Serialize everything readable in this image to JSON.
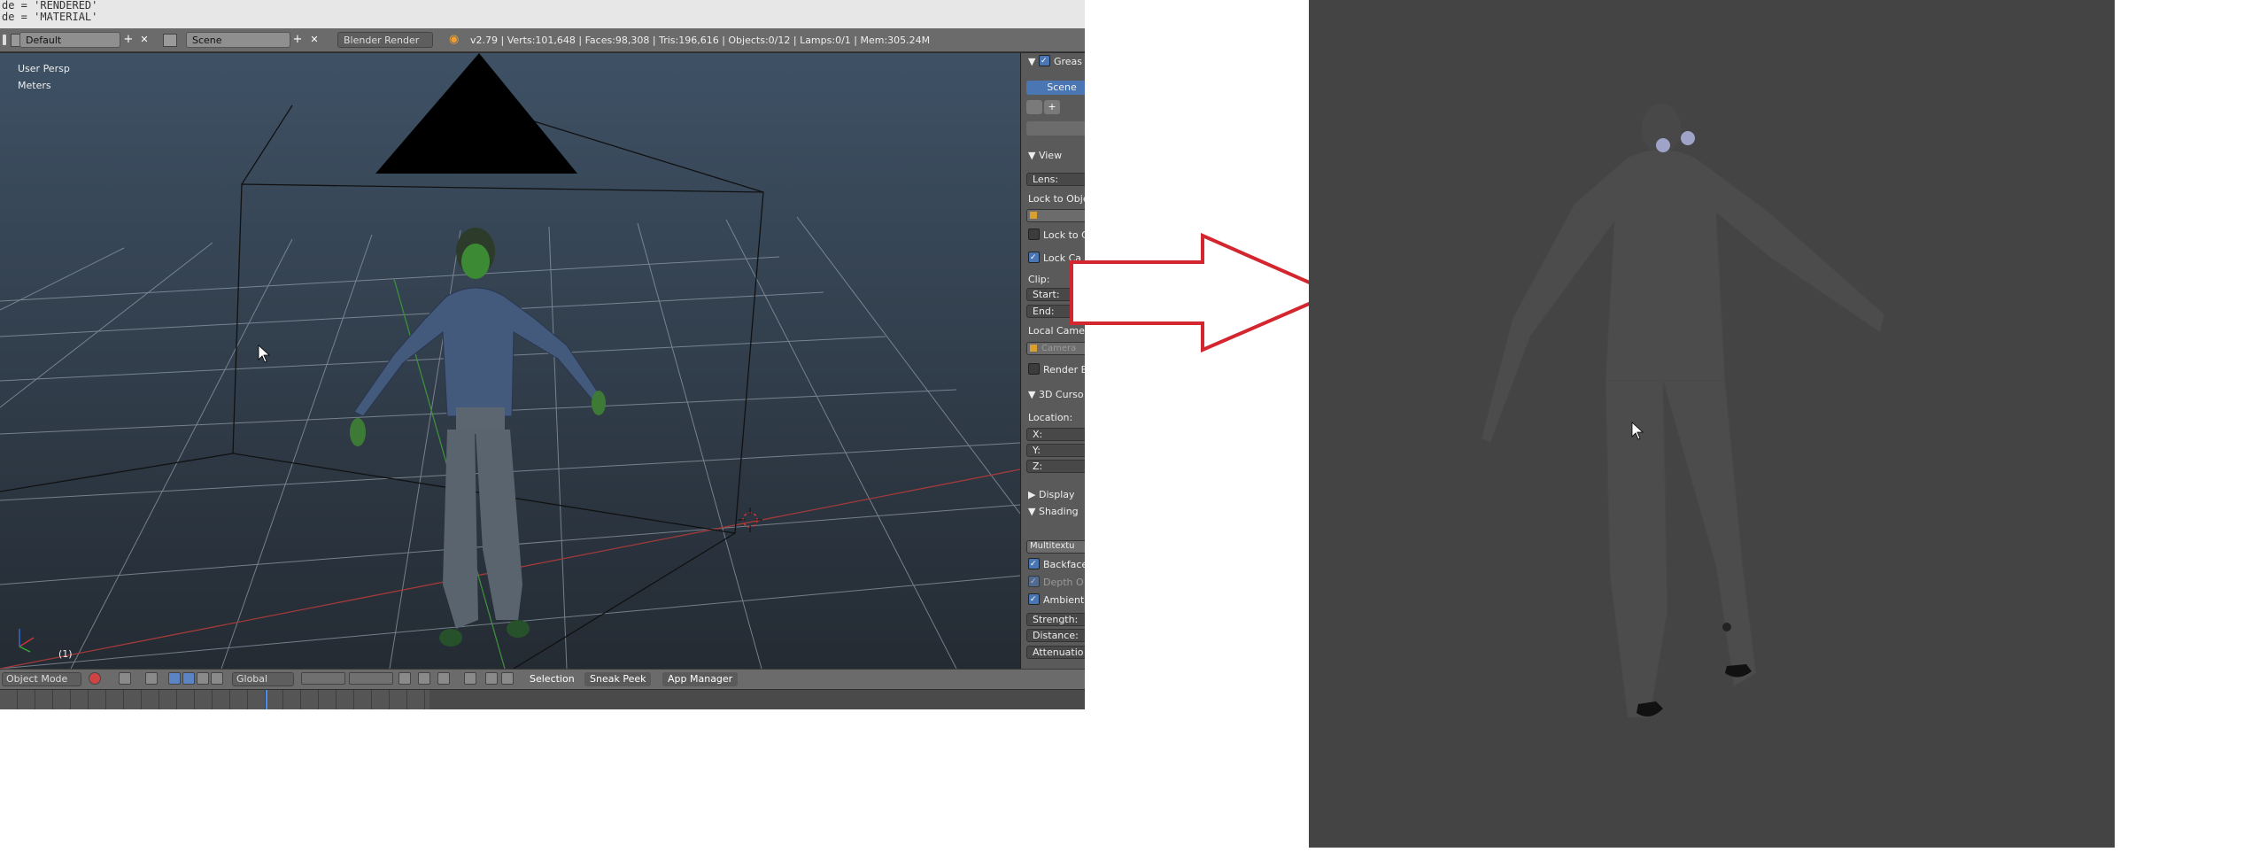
{
  "console": {
    "line1": "de = 'RENDERED'",
    "line2": "de = 'MATERIAL'"
  },
  "infobar": {
    "layout_name": "Default",
    "scene_name": "Scene",
    "render_engine": "Blender Render",
    "stats": "v2.79 | Verts:101,648 | Faces:98,308 | Tris:196,616 | Objects:0/12 | Lamps:0/1 | Mem:305.24M",
    "add_symbol": "+",
    "close_symbol": "✕"
  },
  "viewport": {
    "view_name": "User Persp",
    "units": "Meters",
    "frame": "(1)"
  },
  "npanel": {
    "grease_header": "Greas",
    "scene_tab": "Scene",
    "view_header": "View",
    "lens_label": "Lens:",
    "lock_to_object": "Lock to Obje",
    "lock_to_cursor": "Lock to C",
    "lock_camera": "Lock Ca",
    "clip_label": "Clip:",
    "start_label": "Start:",
    "end_label": "End:",
    "local_camera": "Local Came",
    "local_camera_value": "Camera",
    "render_border": "Render B",
    "cursor_header": "3D Curso",
    "location_label": "Location:",
    "x_label": "X:",
    "y_label": "Y:",
    "z_label": "Z:",
    "display_header": "Display",
    "shading_header": "Shading",
    "shading_mode": "Multitextu",
    "backface": "Backface",
    "depth_of_field": "Depth O",
    "ambient": "Ambient",
    "strength": "Strength:",
    "distance": "Distance:",
    "attenuation": "Attenuatio"
  },
  "bottombar": {
    "mode": "Object Mode",
    "orientation": "Global",
    "menu_selection": "Selection",
    "menu_sneak_peek": "Sneak Peek",
    "menu_app_manager": "App Manager"
  },
  "colors": {
    "accent_blue": "#4a77b3",
    "arrow_red": "#d3262e",
    "render_bg": "#444444",
    "grid_red_axis": "#a33a3a",
    "grid_green_axis": "#3c8f3c"
  },
  "timeline": {
    "playhead_fraction": 0.245
  }
}
